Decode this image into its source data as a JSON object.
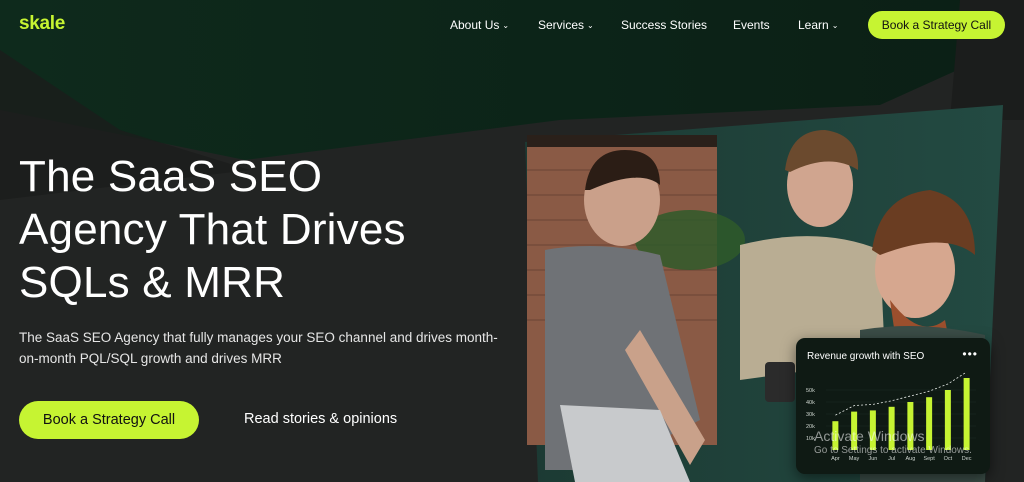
{
  "brand": {
    "logo_text": "skale",
    "accent": "#c6f432"
  },
  "nav": {
    "items": [
      {
        "label": "About Us",
        "dropdown": true
      },
      {
        "label": "Services",
        "dropdown": true
      },
      {
        "label": "Success Stories",
        "dropdown": false
      },
      {
        "label": "Events",
        "dropdown": false
      },
      {
        "label": "Learn",
        "dropdown": true
      }
    ],
    "chevron": "⌄",
    "cta_label": "Book a Strategy Call"
  },
  "hero": {
    "headline_lines": [
      "The SaaS SEO",
      "Agency That Drives",
      "SQLs & MRR"
    ],
    "subtext": "The SaaS SEO Agency that fully manages your SEO channel and drives month-on-month PQL/SQL growth and drives MRR",
    "primary_cta": "Book a Strategy Call",
    "secondary_cta": "Read stories & opinions"
  },
  "revenue_card": {
    "title": "Revenue growth with SEO",
    "menu_icon": "more-horizontal-icon",
    "menu_glyph": "•••",
    "chart_data": {
      "type": "bar",
      "title": "Revenue growth with SEO",
      "categories": [
        "Apr",
        "May",
        "Jun",
        "Jul",
        "Aug",
        "Sept",
        "Oct",
        "Dec"
      ],
      "values": [
        24,
        32,
        33,
        36,
        40,
        44,
        50,
        60
      ],
      "y_ticks": [
        "50k",
        "40k",
        "30k",
        "20k",
        "10k"
      ],
      "ylim": [
        0,
        60
      ],
      "bar_color": "#c6f432",
      "trend_line": true
    }
  },
  "watermark": {
    "line1": "Activate Windows",
    "line2": "Go to Settings to activate Windows."
  }
}
